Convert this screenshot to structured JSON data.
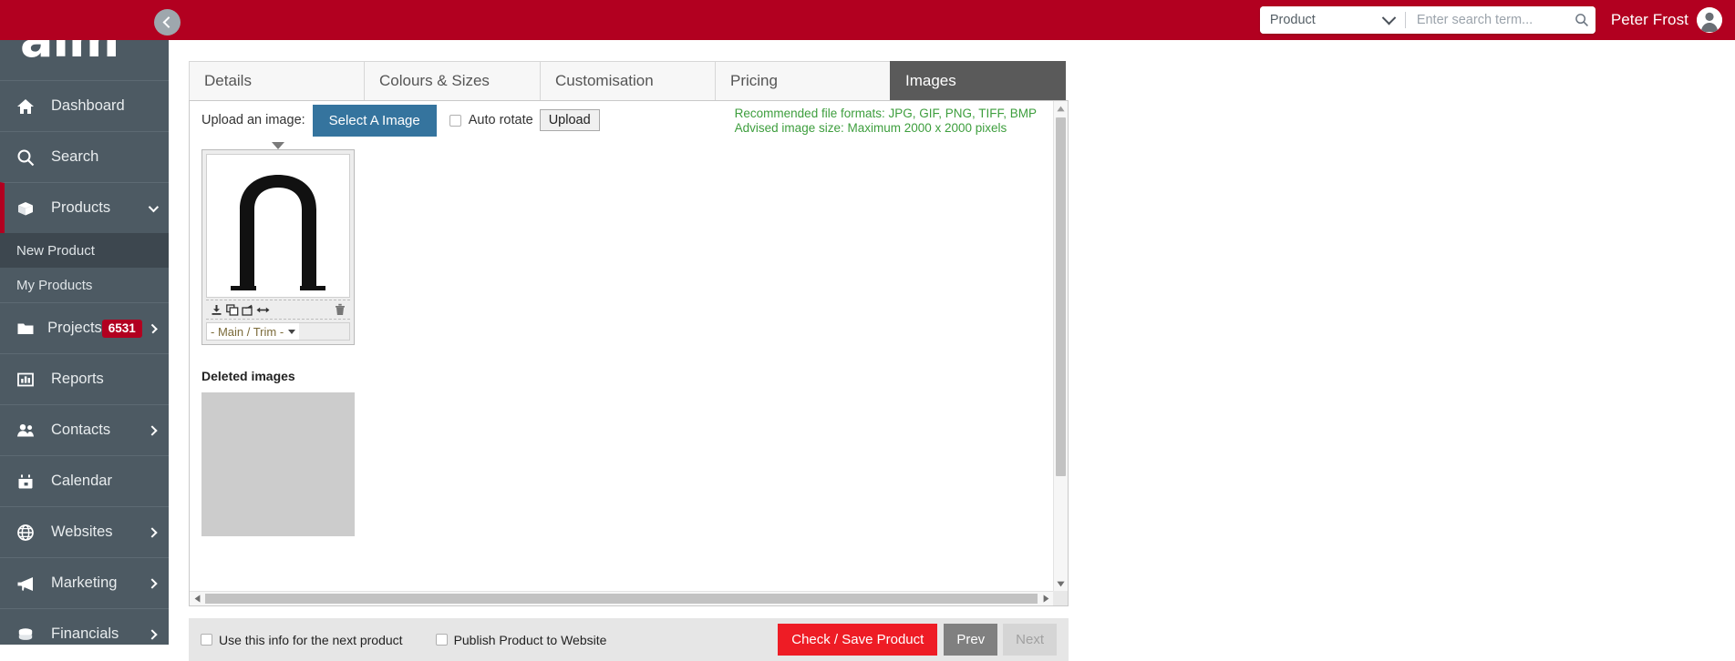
{
  "brand": {
    "logo_text": "aim",
    "trademark": "™",
    "red": "#b20020",
    "sidebar_bg": "#4d5a63"
  },
  "header": {
    "search_scope_value": "Product",
    "search_placeholder": "Enter search term...",
    "search_value": "",
    "user_name": "Peter Frost",
    "search_icon": "magnifier-icon",
    "avatar_icon": "user-avatar-icon",
    "scope_caret_icon": "chevron-down-icon"
  },
  "sidebar": {
    "collapse_icon": "chevron-left-icon",
    "items": [
      {
        "label": "Dashboard",
        "icon": "home-icon",
        "badge": null,
        "chevron": null,
        "active": false
      },
      {
        "label": "Search",
        "icon": "search-icon",
        "badge": null,
        "chevron": null,
        "active": false
      },
      {
        "label": "Products",
        "icon": "box-icon",
        "badge": null,
        "chevron": "chevron-down-icon",
        "active": true
      },
      {
        "label": "Projects",
        "icon": "folder-icon",
        "badge": "6531",
        "chevron": "chevron-right-icon",
        "active": false
      },
      {
        "label": "Reports",
        "icon": "bar-chart-icon",
        "badge": null,
        "chevron": null,
        "active": false
      },
      {
        "label": "Contacts",
        "icon": "people-icon",
        "badge": null,
        "chevron": "chevron-right-icon",
        "active": false
      },
      {
        "label": "Calendar",
        "icon": "calendar-icon",
        "badge": null,
        "chevron": null,
        "active": false
      },
      {
        "label": "Websites",
        "icon": "globe-icon",
        "badge": null,
        "chevron": "chevron-right-icon",
        "active": false
      },
      {
        "label": "Marketing",
        "icon": "megaphone-icon",
        "badge": null,
        "chevron": "chevron-right-icon",
        "active": false
      },
      {
        "label": "Financials",
        "icon": "coins-icon",
        "badge": null,
        "chevron": "chevron-right-icon",
        "active": false
      }
    ],
    "subitems": [
      {
        "label": "New Product",
        "selected": true
      },
      {
        "label": "My Products",
        "selected": false
      }
    ]
  },
  "tabs": [
    {
      "label": "Details",
      "active": false
    },
    {
      "label": "Colours & Sizes",
      "active": false
    },
    {
      "label": "Customisation",
      "active": false
    },
    {
      "label": "Pricing",
      "active": false
    },
    {
      "label": "Images",
      "active": true
    }
  ],
  "images_tab": {
    "upload_label": "Upload an image:",
    "select_button": "Select A Image",
    "auto_rotate_label": "Auto rotate",
    "auto_rotate_checked": false,
    "upload_button": "Upload",
    "recommendation_line1": "Recommended file formats: JPG, GIF, PNG, TIFF, BMP",
    "recommendation_line2": "Advised image size: Maximum 2000 x 2000 pixels",
    "thumbnail": {
      "caret_icon": "caret-down-icon",
      "tools": [
        {
          "name": "download-icon"
        },
        {
          "name": "duplicate-icon"
        },
        {
          "name": "rotate-icon"
        },
        {
          "name": "flip-horizontal-icon"
        }
      ],
      "delete_icon": "trash-icon",
      "select_value": "- Main / Trim -",
      "select_caret_icon": "caret-down-icon"
    },
    "deleted_images_label": "Deleted images",
    "vscroll_up_icon": "triangle-up-icon",
    "vscroll_down_icon": "triangle-down-icon",
    "hscroll_left_icon": "triangle-left-icon",
    "hscroll_right_icon": "triangle-right-icon"
  },
  "footer": {
    "use_info_label": "Use this info for the next product",
    "use_info_checked": false,
    "publish_label": "Publish Product to Website",
    "publish_checked": false,
    "save_button": "Check / Save Product",
    "prev_button": "Prev",
    "next_button": "Next"
  }
}
